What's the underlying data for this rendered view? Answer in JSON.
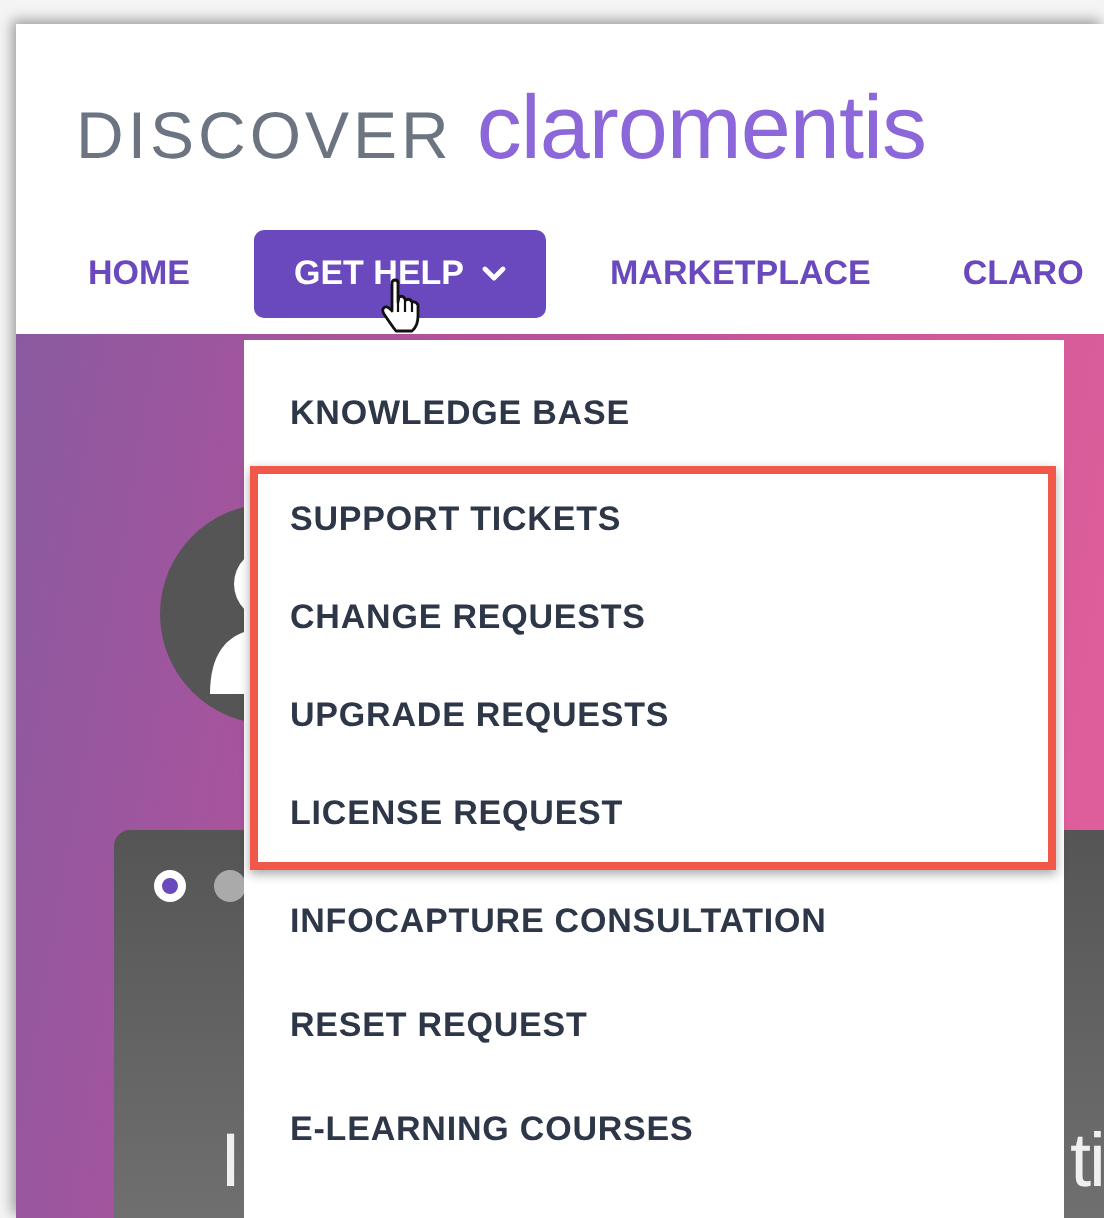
{
  "logo": {
    "prefix": "DISCOVER",
    "name": "claromentis"
  },
  "nav": [
    {
      "label": "HOME",
      "selected": false,
      "has_menu": false
    },
    {
      "label": "GET HELP",
      "selected": true,
      "has_menu": true
    },
    {
      "label": "MARKETPLACE",
      "selected": false,
      "has_menu": false
    },
    {
      "label": "CLARO",
      "selected": false,
      "has_menu": false
    }
  ],
  "dropdown": {
    "items": [
      {
        "label": "KNOWLEDGE BASE",
        "highlighted": false
      },
      {
        "label": "SUPPORT TICKETS",
        "highlighted": true
      },
      {
        "label": "CHANGE REQUESTS",
        "highlighted": true
      },
      {
        "label": "UPGRADE REQUESTS",
        "highlighted": true
      },
      {
        "label": "LICENSE REQUEST",
        "highlighted": true
      },
      {
        "label": "INFOCAPTURE CONSULTATION",
        "highlighted": false
      },
      {
        "label": "RESET REQUEST",
        "highlighted": false
      },
      {
        "label": "E-LEARNING COURSES",
        "highlighted": false
      }
    ]
  },
  "carousel": {
    "dots": [
      {
        "selected": true
      },
      {
        "selected": false
      }
    ]
  },
  "card": {
    "heading_left": "I",
    "heading_right": "ti"
  }
}
